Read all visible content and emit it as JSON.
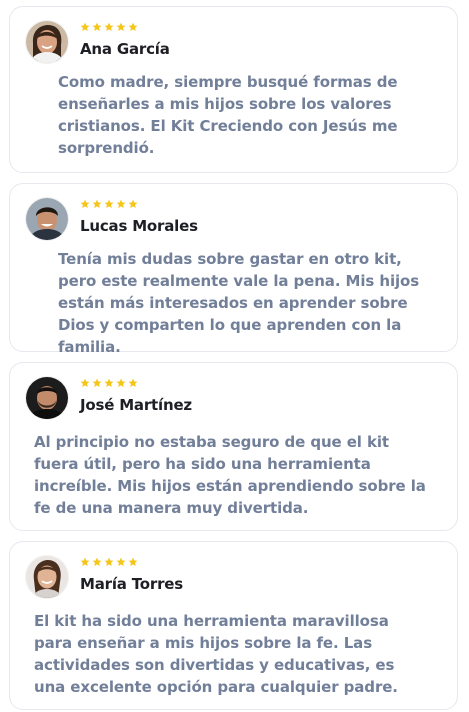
{
  "colors": {
    "star": "#f5c518",
    "name": "#1e1f24",
    "review_text": "#727f99",
    "card_border": "#e6e8ee"
  },
  "star_icon": "star-icon",
  "reviews": [
    {
      "name": "Ana García",
      "rating": 5,
      "text": "Como madre, siempre busqué formas de enseñarles a mis hijos sobre los valores cristianos. El Kit Creciendo con Jesús me sorprendió."
    },
    {
      "name": "Lucas Morales",
      "rating": 5,
      "text": "Tenía mis dudas sobre gastar en otro kit, pero este realmente vale la pena. Mis hijos están más interesados en aprender sobre Dios y comparten lo que aprenden con la familia."
    },
    {
      "name": "José Martínez",
      "rating": 5,
      "text": "Al principio no estaba seguro de que el kit fuera útil, pero ha sido una herramienta increíble. Mis hijos están aprendiendo sobre la fe de una manera muy divertida."
    },
    {
      "name": "María Torres",
      "rating": 5,
      "text": "El kit ha sido una herramienta maravillosa para enseñar a mis hijos sobre la fe. Las actividades son divertidas y educativas, es una excelente opción para cualquier padre."
    }
  ]
}
